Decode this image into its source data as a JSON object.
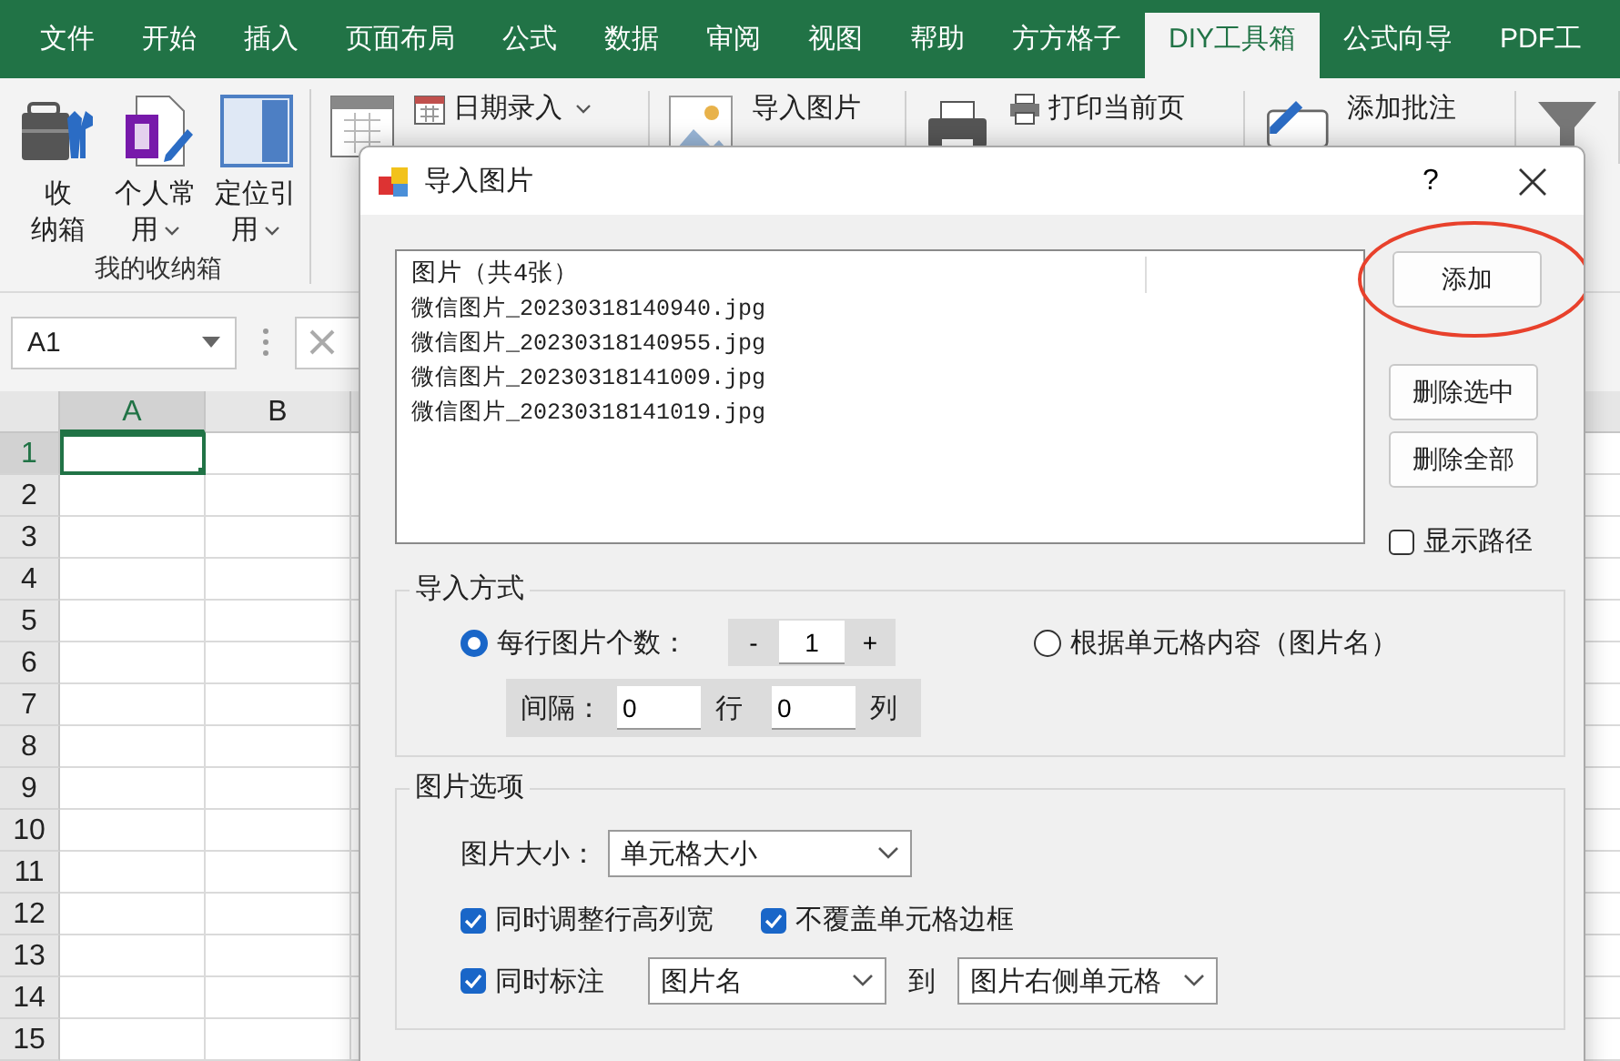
{
  "ribbon_tabs": [
    {
      "label": "文件",
      "selected": false
    },
    {
      "label": "开始",
      "selected": false
    },
    {
      "label": "插入",
      "selected": false
    },
    {
      "label": "页面布局",
      "selected": false
    },
    {
      "label": "公式",
      "selected": false
    },
    {
      "label": "数据",
      "selected": false
    },
    {
      "label": "审阅",
      "selected": false
    },
    {
      "label": "视图",
      "selected": false
    },
    {
      "label": "帮助",
      "selected": false
    },
    {
      "label": "方方格子",
      "selected": false
    },
    {
      "label": "DIY工具箱",
      "selected": true
    },
    {
      "label": "公式向导",
      "selected": false
    },
    {
      "label": "PDF工",
      "selected": false
    }
  ],
  "ribbon": {
    "group": {
      "label": "我的收纳箱",
      "buttons": [
        {
          "kind": "toolbox",
          "lines": [
            "收",
            "纳箱"
          ],
          "dropdown": false
        },
        {
          "kind": "document",
          "lines": [
            "个人常",
            "用"
          ],
          "dropdown": true
        },
        {
          "kind": "panel",
          "lines": [
            "定位引",
            "用"
          ],
          "dropdown": true
        }
      ]
    },
    "tools": [
      {
        "kind": "calendar",
        "label": "日期录入",
        "dropdown": true
      },
      {
        "kind": "image",
        "label": "导入图片",
        "dropdown": false
      },
      {
        "kind": "printer",
        "label": "打印当前页",
        "dropdown": false
      },
      {
        "kind": "comment",
        "label": "添加批注",
        "dropdown": false
      },
      {
        "kind": "funnel"
      }
    ]
  },
  "name_box": {
    "value": "A1"
  },
  "sheet": {
    "columns": [
      {
        "label": "A",
        "selected": true
      },
      {
        "label": "B",
        "selected": false
      }
    ],
    "rows": [
      {
        "label": "1",
        "selected": true
      },
      {
        "label": "2",
        "selected": false
      },
      {
        "label": "3",
        "selected": false
      },
      {
        "label": "4",
        "selected": false
      },
      {
        "label": "5",
        "selected": false
      },
      {
        "label": "6",
        "selected": false
      },
      {
        "label": "7",
        "selected": false
      },
      {
        "label": "8",
        "selected": false
      },
      {
        "label": "9",
        "selected": false
      },
      {
        "label": "10",
        "selected": false
      },
      {
        "label": "11",
        "selected": false
      },
      {
        "label": "12",
        "selected": false
      },
      {
        "label": "13",
        "selected": false
      },
      {
        "label": "14",
        "selected": false
      },
      {
        "label": "15",
        "selected": false
      }
    ]
  },
  "dialog": {
    "title": "导入图片",
    "help": "?",
    "file_list": {
      "header": "图片（共4张）",
      "items": [
        "微信图片_20230318140940.jpg",
        "微信图片_20230318140955.jpg",
        "微信图片_20230318141009.jpg",
        "微信图片_20230318141019.jpg"
      ]
    },
    "buttons": [
      {
        "label": "添加",
        "highlighted": true
      },
      {
        "label": "删除选中",
        "highlighted": false
      },
      {
        "label": "删除全部",
        "highlighted": false
      }
    ],
    "show_path": {
      "label": "显示路径",
      "checked": false
    },
    "import_mode": {
      "title": "导入方式",
      "options": [
        {
          "label": "每行图片个数：",
          "selected": true
        },
        {
          "label": "根据单元格内容（图片名）",
          "selected": false
        }
      ],
      "stepper": {
        "minus": "-",
        "value": "1",
        "plus": "+"
      },
      "spacing": {
        "label": "间隔：",
        "rows": "0",
        "rows_unit": "行",
        "cols": "0",
        "cols_unit": "列"
      }
    },
    "image_options": {
      "title": "图片选项",
      "size": {
        "label": "图片大小：",
        "value": "单元格大小"
      },
      "checks": [
        {
          "label": "同时调整行高列宽",
          "checked": true
        },
        {
          "label": "不覆盖单元格边框",
          "checked": true
        }
      ],
      "annotate": {
        "label": "同时标注",
        "checked": true,
        "what": "图片名",
        "to": "到",
        "where": "图片右侧单元格"
      }
    }
  }
}
